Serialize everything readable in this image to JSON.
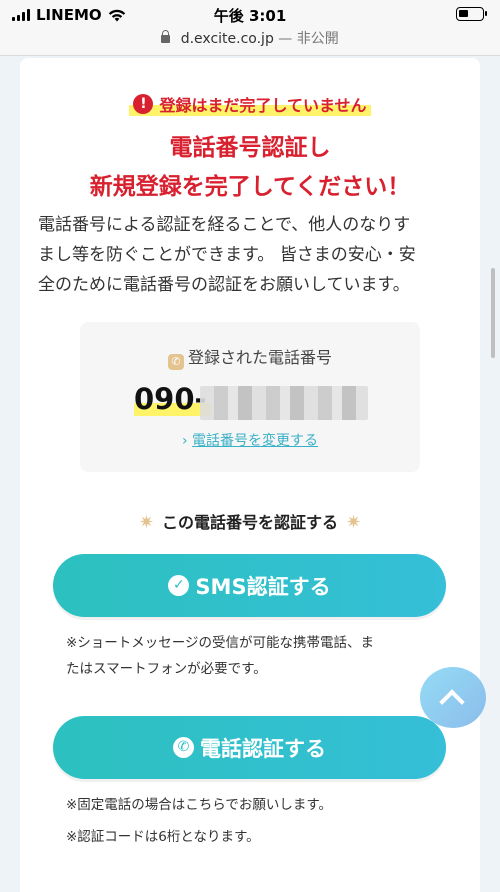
{
  "status_bar": {
    "carrier": "LINEMO",
    "time": "午後 3:01"
  },
  "url_bar": {
    "domain": "d.excite.co.jp",
    "separator": "—",
    "status": "非公開"
  },
  "alert": {
    "icon": "!",
    "text": "登録はまだ完了していません"
  },
  "headline": {
    "line1": "電話番号認証し",
    "line2": "新規登録を完了してください！"
  },
  "description": {
    "line1": "電話番号による認証を経ることで、他人のなりす",
    "line2": "まし等を防ぐことができます。 皆さまの安心・安",
    "line3": "全のために電話番号の認証をお願いしています。"
  },
  "registered_phone": {
    "label": "登録された電話番号",
    "number_prefix": "090-",
    "change_link_arrow": "›",
    "change_link": "電話番号を変更する"
  },
  "verify_section": {
    "title": "この電話番号を認証する",
    "spark": "✷"
  },
  "sms_button": {
    "label": "SMS認証する",
    "icon": "✓",
    "note_line1": "※ショートメッセージの受信が可能な携帯電話、ま",
    "note_line2": "たはスマートフォンが必要です。"
  },
  "phone_button": {
    "label": "電話認証する",
    "icon": "✆",
    "note_line1": "※固定電話の場合はこちらでお願いします。",
    "note_line2": "※認証コードは6桁となります。"
  },
  "colors": {
    "accent_red": "#d8202f",
    "button_teal": "#2cc1bf",
    "highlight_yellow": "#fff36a"
  }
}
